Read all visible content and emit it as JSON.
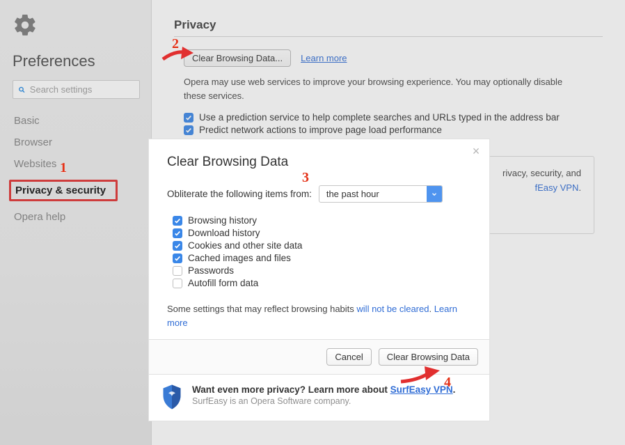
{
  "sidebar": {
    "title": "Preferences",
    "search_placeholder": "Search settings",
    "items": [
      {
        "label": "Basic"
      },
      {
        "label": "Browser"
      },
      {
        "label": "Websites"
      },
      {
        "label": "Privacy & security"
      },
      {
        "label": "Opera help"
      }
    ]
  },
  "privacy": {
    "heading": "Privacy",
    "clear_button": "Clear Browsing Data...",
    "learn_more": "Learn more",
    "services_desc": "Opera may use web services to improve your browsing experience. You may optionally disable these services.",
    "opt_prediction": "Use a prediction service to help complete searches and URLs typed in the address bar",
    "opt_network": "Predict network actions to improve page load performance",
    "vpn_card_right": "rivacy, security, and",
    "vpn_card_link": "fEasy VPN"
  },
  "modal": {
    "title": "Clear Browsing Data",
    "obliterate_label": "Obliterate the following items from:",
    "time_range": "the past hour",
    "options": [
      {
        "label": "Browsing history",
        "checked": true
      },
      {
        "label": "Download history",
        "checked": true
      },
      {
        "label": "Cookies and other site data",
        "checked": true
      },
      {
        "label": "Cached images and files",
        "checked": true
      },
      {
        "label": "Passwords",
        "checked": false
      },
      {
        "label": "Autofill form data",
        "checked": false
      }
    ],
    "note_pre": "Some settings that may reflect browsing habits ",
    "note_link": "will not be cleared",
    "note_dot": ". ",
    "note_learn": "Learn more",
    "cancel": "Cancel",
    "confirm": "Clear Browsing Data",
    "promo_line1_a": "Want even more privacy? Learn more about ",
    "promo_link": "SurfEasy VPN",
    "promo_line1_b": ".",
    "promo_line2": "SurfEasy is an Opera Software company."
  },
  "annotations": {
    "n1": "1",
    "n2": "2",
    "n3": "3",
    "n4": "4"
  }
}
